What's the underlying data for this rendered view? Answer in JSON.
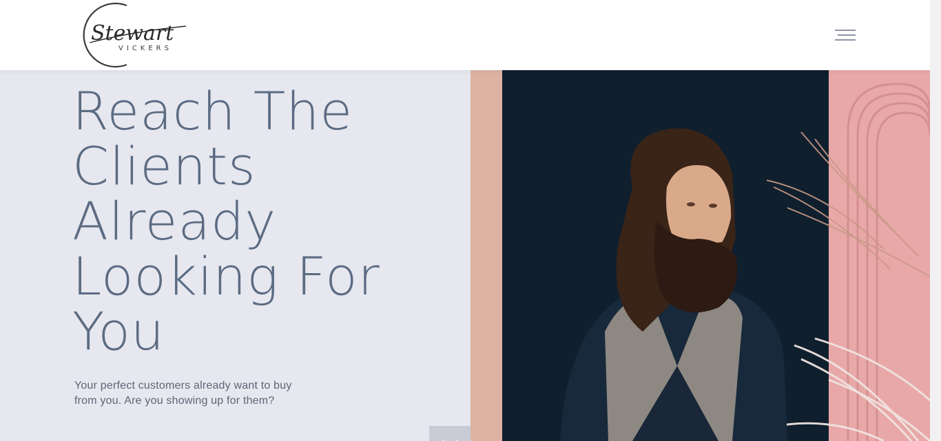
{
  "brand": {
    "logo_script": "Stewart",
    "logo_sub": "VICKERS"
  },
  "nav": {
    "menu_icon": "hamburger-menu-icon"
  },
  "hero": {
    "title_lines": [
      "Reach The",
      "Clients",
      "Already",
      "Looking For",
      "You"
    ],
    "subtitle": "Your perfect customers already want to buy from you. Are you showing up for them?",
    "scroll_icon": "chevron-down-icon"
  },
  "colors": {
    "background": "#e6e7ef",
    "title": "#5b6b82",
    "subtitle": "#5e6475",
    "header": "#ffffff",
    "photo_backdrop": "#0f1f2e",
    "photo_pink": "#e8a8a8"
  }
}
